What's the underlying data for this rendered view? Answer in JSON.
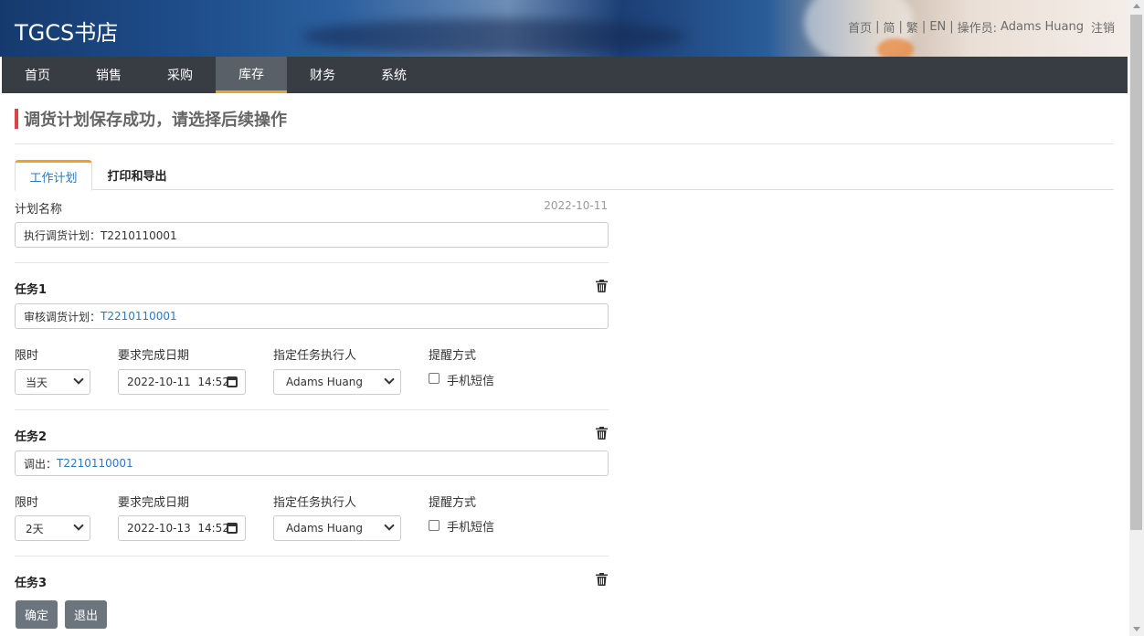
{
  "header": {
    "logo": "TGCS书店",
    "links": [
      "首页",
      "简",
      "繁",
      "EN"
    ],
    "operator_label": "操作员:",
    "operator_name": "Adams Huang",
    "logout": "注销",
    "separator": "|"
  },
  "nav": {
    "items": [
      "首页",
      "销售",
      "采购",
      "库存",
      "财务",
      "系统"
    ],
    "active_index": 3
  },
  "page": {
    "title": "调货计划保存成功，请选择后续操作",
    "tabs": [
      "工作计划",
      "打印和导出"
    ],
    "plan_name_label": "计划名称",
    "date": "2022-10-11",
    "plan_name_value": "执行调货计划：T2210110001"
  },
  "tasks": [
    {
      "title": "任务1",
      "desc_prefix": "审核调货计划：",
      "desc_link": "T2210110001",
      "limit_label": "限时",
      "limit_value": "当天",
      "due_label": "要求完成日期",
      "due_value": "2022-10-11  14:52",
      "assignee_label": "指定任务执行人",
      "assignee_value": "Adams Huang",
      "remind_label": "提醒方式",
      "sms_label": "手机短信",
      "sms_checked": false
    },
    {
      "title": "任务2",
      "desc_prefix": "调出：",
      "desc_link": "T2210110001",
      "limit_label": "限时",
      "limit_value": "2天",
      "due_label": "要求完成日期",
      "due_value": "2022-10-13  14:52",
      "assignee_label": "指定任务执行人",
      "assignee_value": "Adams Huang",
      "remind_label": "提醒方式",
      "sms_label": "手机短信",
      "sms_checked": false
    },
    {
      "title": "任务3"
    }
  ],
  "actions": {
    "confirm": "确定",
    "exit": "退出"
  },
  "colors": {
    "nav_bg": "#383d43",
    "accent": "#f0a030",
    "title_bar": "#d9434a",
    "link": "#2e77c4",
    "button": "#6c757d"
  }
}
